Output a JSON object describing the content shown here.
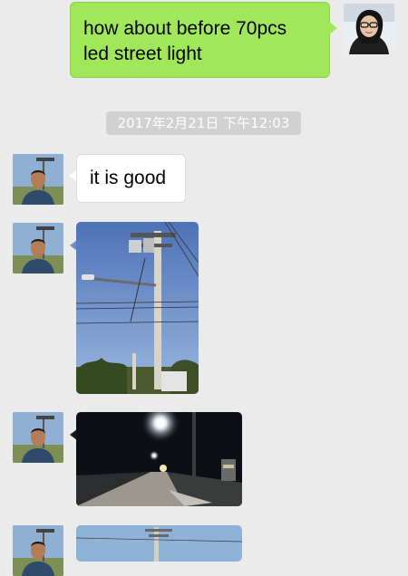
{
  "messages": {
    "outgoing_1": {
      "sender": "me",
      "line1": "how about before  70pcs",
      "line2": "led street light"
    },
    "timestamp": "2017年2月21日 下午12:03",
    "incoming_text": "it is good",
    "incoming_images": [
      {
        "kind": "photo",
        "subject": "utility pole with street light, daytime"
      },
      {
        "kind": "photo",
        "subject": "street lights at night on road"
      },
      {
        "kind": "photo",
        "subject": "utility pole, partially visible"
      }
    ]
  },
  "colors": {
    "background": "#ebebeb",
    "outgoing_bubble": "#a0e75a",
    "incoming_bubble": "#ffffff",
    "timestamp_bg": "#d1d1d1"
  }
}
